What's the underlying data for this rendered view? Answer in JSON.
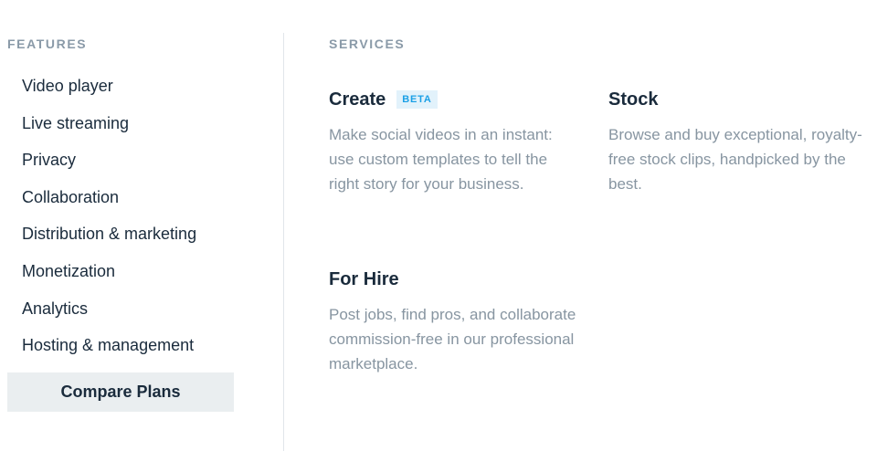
{
  "features": {
    "heading": "FEATURES",
    "items": [
      {
        "label": "Video player"
      },
      {
        "label": "Live streaming"
      },
      {
        "label": "Privacy"
      },
      {
        "label": "Collaboration"
      },
      {
        "label": "Distribution & marketing"
      },
      {
        "label": "Monetization"
      },
      {
        "label": "Analytics"
      },
      {
        "label": "Hosting & management"
      }
    ],
    "compare_button": "Compare Plans"
  },
  "services": {
    "heading": "SERVICES",
    "create": {
      "title": "Create",
      "badge": "BETA",
      "description": "Make social videos in an instant: use custom templates to tell the right story for your business."
    },
    "stock": {
      "title": "Stock",
      "description": "Browse and buy exceptional, royalty-free stock clips, handpicked by the best."
    },
    "for_hire": {
      "title": "For Hire",
      "description": "Post jobs, find pros, and collaborate commission-free in our professional marketplace."
    }
  },
  "colors": {
    "heading": "#1a2b3c",
    "muted": "#8795a1",
    "beta_bg": "#e2f2fb",
    "beta_text": "#1ba0e6",
    "button_bg": "#eaeef0"
  }
}
